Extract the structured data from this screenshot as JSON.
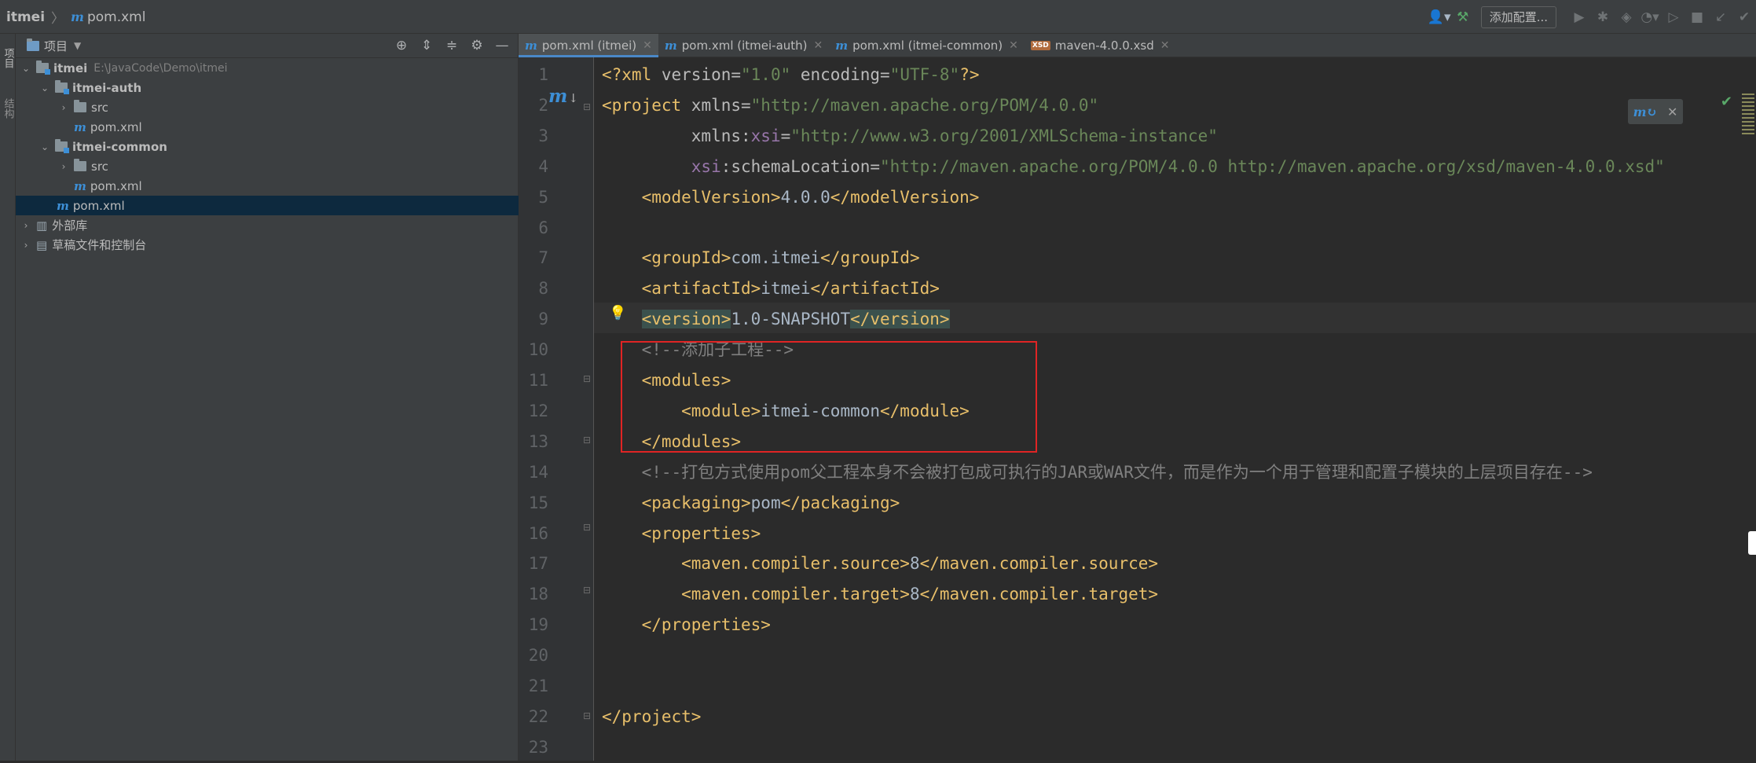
{
  "breadcrumb": {
    "project": "itmei",
    "file": "pom.xml"
  },
  "toolbar": {
    "add_config_label": "添加配置..."
  },
  "tool_windows": {
    "project_label": "项目",
    "structure_label": "结构"
  },
  "project_panel": {
    "title": "项目",
    "tree": [
      {
        "label": "itmei",
        "path": "E:\\JavaCode\\Demo\\itmei"
      },
      {
        "label": "itmei-auth"
      },
      {
        "label": "src"
      },
      {
        "label": "pom.xml"
      },
      {
        "label": "itmei-common"
      },
      {
        "label": "src"
      },
      {
        "label": "pom.xml"
      },
      {
        "label": "pom.xml"
      },
      {
        "label": "外部库"
      },
      {
        "label": "草稿文件和控制台"
      }
    ]
  },
  "tabs": [
    {
      "label": "pom.xml (itmei)"
    },
    {
      "label": "pom.xml (itmei-auth)"
    },
    {
      "label": "pom.xml (itmei-common)"
    },
    {
      "label": "maven-4.0.0.xsd"
    }
  ],
  "editor": {
    "lines": [
      {
        "n": "1",
        "segs": [
          [
            "pi",
            "<?xml "
          ],
          [
            "a",
            "version="
          ],
          [
            "s",
            "\"1.0\""
          ],
          [
            "a",
            " encoding="
          ],
          [
            "s",
            "\"UTF-8\""
          ],
          [
            "pi",
            "?>"
          ]
        ]
      },
      {
        "n": "2",
        "segs": [
          [
            "t",
            "<project "
          ],
          [
            "a",
            "xmlns="
          ],
          [
            "s",
            "\"http://maven.apache.org/POM/4.0.0\""
          ]
        ]
      },
      {
        "n": "3",
        "segs": [
          [
            "a",
            "         xmlns:"
          ],
          [
            "ns",
            "xsi"
          ],
          [
            "a",
            "="
          ],
          [
            "s",
            "\"http://www.w3.org/2001/XMLSchema-instance\""
          ]
        ]
      },
      {
        "n": "4",
        "segs": [
          [
            "ns",
            "         xsi"
          ],
          [
            "a",
            ":schemaLocation="
          ],
          [
            "s",
            "\"http://maven.apache.org/POM/4.0.0 http://maven.apache.org/xsd/maven-4.0.0.xsd\""
          ]
        ]
      },
      {
        "n": "5",
        "segs": [
          [
            "t",
            "    <modelVersion>"
          ],
          [
            "txt",
            "4.0.0"
          ],
          [
            "t",
            "</modelVersion>"
          ]
        ]
      },
      {
        "n": "6",
        "segs": []
      },
      {
        "n": "7",
        "segs": [
          [
            "t",
            "    <groupId>"
          ],
          [
            "txt",
            "com.itmei"
          ],
          [
            "t",
            "</groupId>"
          ]
        ]
      },
      {
        "n": "8",
        "segs": [
          [
            "t",
            "    <artifactId>"
          ],
          [
            "txt",
            "itmei"
          ],
          [
            "t",
            "</artifactId>"
          ]
        ]
      },
      {
        "n": "9",
        "segs": [
          [
            "txt",
            "    "
          ],
          [
            "t hl-tag",
            "<version>"
          ],
          [
            "txt",
            "1.0-SNAPSHOT"
          ],
          [
            "t hl-tag",
            "</version>"
          ]
        ]
      },
      {
        "n": "10",
        "segs": [
          [
            "c",
            "    <!--添加子工程-->"
          ]
        ]
      },
      {
        "n": "11",
        "segs": [
          [
            "t",
            "    <modules>"
          ]
        ]
      },
      {
        "n": "12",
        "segs": [
          [
            "t",
            "        <module>"
          ],
          [
            "txt",
            "itmei-common"
          ],
          [
            "t",
            "</module>"
          ]
        ]
      },
      {
        "n": "13",
        "segs": [
          [
            "t",
            "    </modules>"
          ]
        ]
      },
      {
        "n": "14",
        "segs": [
          [
            "c",
            "    <!--打包方式使用pom父工程本身不会被打包成可执行的JAR或WAR文件，而是作为一个用于管理和配置子模块的上层项目存在-->"
          ]
        ]
      },
      {
        "n": "15",
        "segs": [
          [
            "t",
            "    <packaging>"
          ],
          [
            "txt",
            "pom"
          ],
          [
            "t",
            "</packaging>"
          ]
        ]
      },
      {
        "n": "16",
        "segs": [
          [
            "t",
            "    <properties>"
          ]
        ]
      },
      {
        "n": "17",
        "segs": [
          [
            "t",
            "        <maven.compiler.source>"
          ],
          [
            "txt",
            "8"
          ],
          [
            "t",
            "</maven.compiler.source>"
          ]
        ]
      },
      {
        "n": "18",
        "segs": [
          [
            "t",
            "        <maven.compiler.target>"
          ],
          [
            "txt",
            "8"
          ],
          [
            "t",
            "</maven.compiler.target>"
          ]
        ]
      },
      {
        "n": "19",
        "segs": [
          [
            "t",
            "    </properties>"
          ]
        ]
      },
      {
        "n": "20",
        "segs": []
      },
      {
        "n": "21",
        "segs": []
      },
      {
        "n": "22",
        "segs": [
          [
            "t",
            "</project>"
          ]
        ]
      },
      {
        "n": "23",
        "segs": []
      }
    ]
  }
}
